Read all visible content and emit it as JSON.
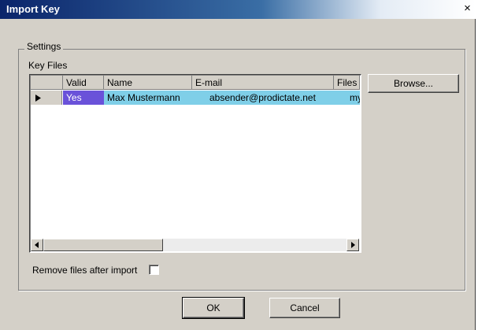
{
  "window": {
    "title": "Import Key",
    "close_glyph": "×"
  },
  "settings": {
    "legend": "Settings",
    "key_files_label": "Key Files",
    "table": {
      "columns": [
        "Valid",
        "Name",
        "E-mail",
        "Files"
      ],
      "rows": [
        {
          "valid": "Yes",
          "name": "Max Mustermann",
          "email": "absender@prodictate.net",
          "files": "my"
        }
      ],
      "selected_row": 0,
      "valid_cell_color": "#6a52d9",
      "selection_color": "#7fcfe8"
    },
    "browse_label": "Browse...",
    "remove_files_label": "Remove files after import",
    "remove_files_checked": false
  },
  "buttons": {
    "ok": "OK",
    "cancel": "Cancel"
  },
  "icons": {
    "row_pointer": "row-pointer-icon",
    "scroll_left": "arrow-left-icon",
    "scroll_right": "arrow-right-icon"
  }
}
